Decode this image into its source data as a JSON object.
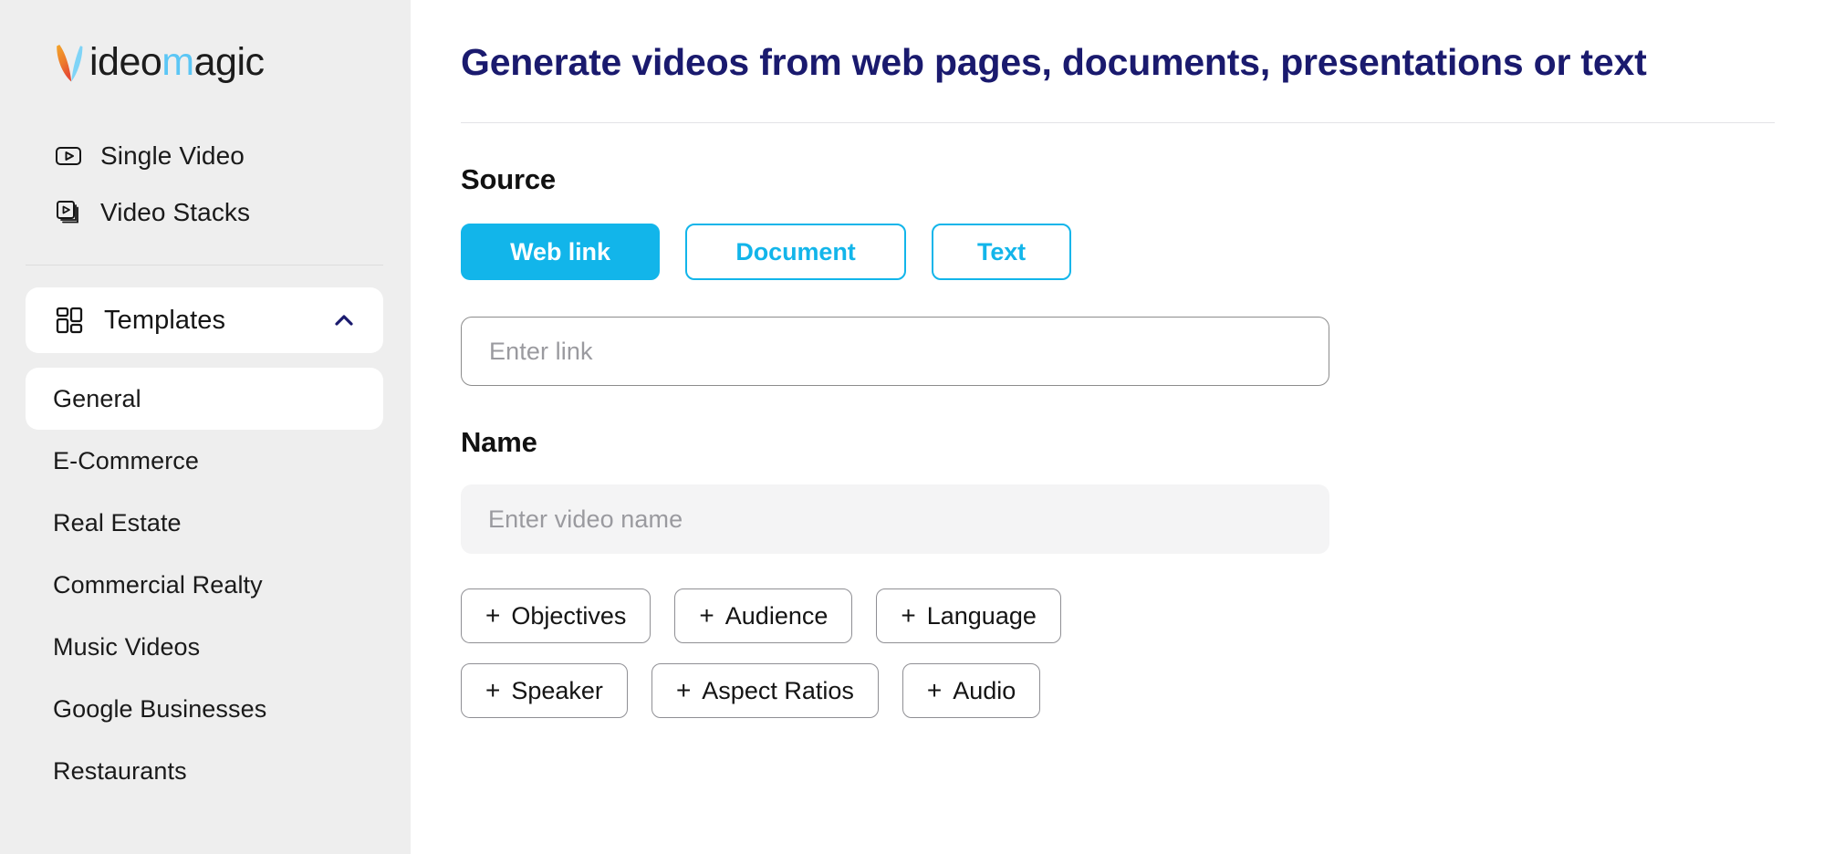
{
  "brand": {
    "name_part1": "ideo",
    "name_part2": "m",
    "name_part3": "agic",
    "mark_icon": "leaf-v-logo-icon",
    "colors": {
      "orange": "#f0922b",
      "red": "#e8503a",
      "light_blue": "#7fd4f7",
      "brand_blue": "#5bc6f5"
    }
  },
  "sidebar": {
    "nav": [
      {
        "label": "Single Video",
        "icon": "single-video-icon"
      },
      {
        "label": "Video Stacks",
        "icon": "video-stacks-icon"
      }
    ],
    "templates": {
      "label": "Templates",
      "icon": "grid-layout-icon",
      "chevron": "chevron-up-icon",
      "expanded": true,
      "items": [
        {
          "label": "General",
          "selected": true
        },
        {
          "label": "E-Commerce",
          "selected": false
        },
        {
          "label": "Real Estate",
          "selected": false
        },
        {
          "label": "Commercial Realty",
          "selected": false
        },
        {
          "label": "Music Videos",
          "selected": false
        },
        {
          "label": "Google Businesses",
          "selected": false
        },
        {
          "label": "Restaurants",
          "selected": false
        }
      ]
    }
  },
  "main": {
    "title": "Generate videos from web pages, documents, presentations or text",
    "source": {
      "label": "Source",
      "buttons": [
        {
          "label": "Web link",
          "active": true
        },
        {
          "label": "Document",
          "active": false
        },
        {
          "label": "Text",
          "active": false
        }
      ],
      "link_input": {
        "value": "",
        "placeholder": "Enter link"
      }
    },
    "name": {
      "label": "Name",
      "input": {
        "value": "",
        "placeholder": "Enter video name"
      }
    },
    "options": {
      "row1": [
        {
          "label": "Objectives",
          "plus": "+"
        },
        {
          "label": "Audience",
          "plus": "+"
        },
        {
          "label": "Language",
          "plus": "+"
        }
      ],
      "row2": [
        {
          "label": "Speaker",
          "plus": "+"
        },
        {
          "label": "Aspect Ratios",
          "plus": "+"
        },
        {
          "label": "Audio",
          "plus": "+"
        }
      ]
    }
  },
  "colors": {
    "accent_cyan": "#12b5ea",
    "title_navy": "#1a1a6e",
    "sidebar_bg": "#eeeeee",
    "field_fill": "#f4f4f5"
  }
}
